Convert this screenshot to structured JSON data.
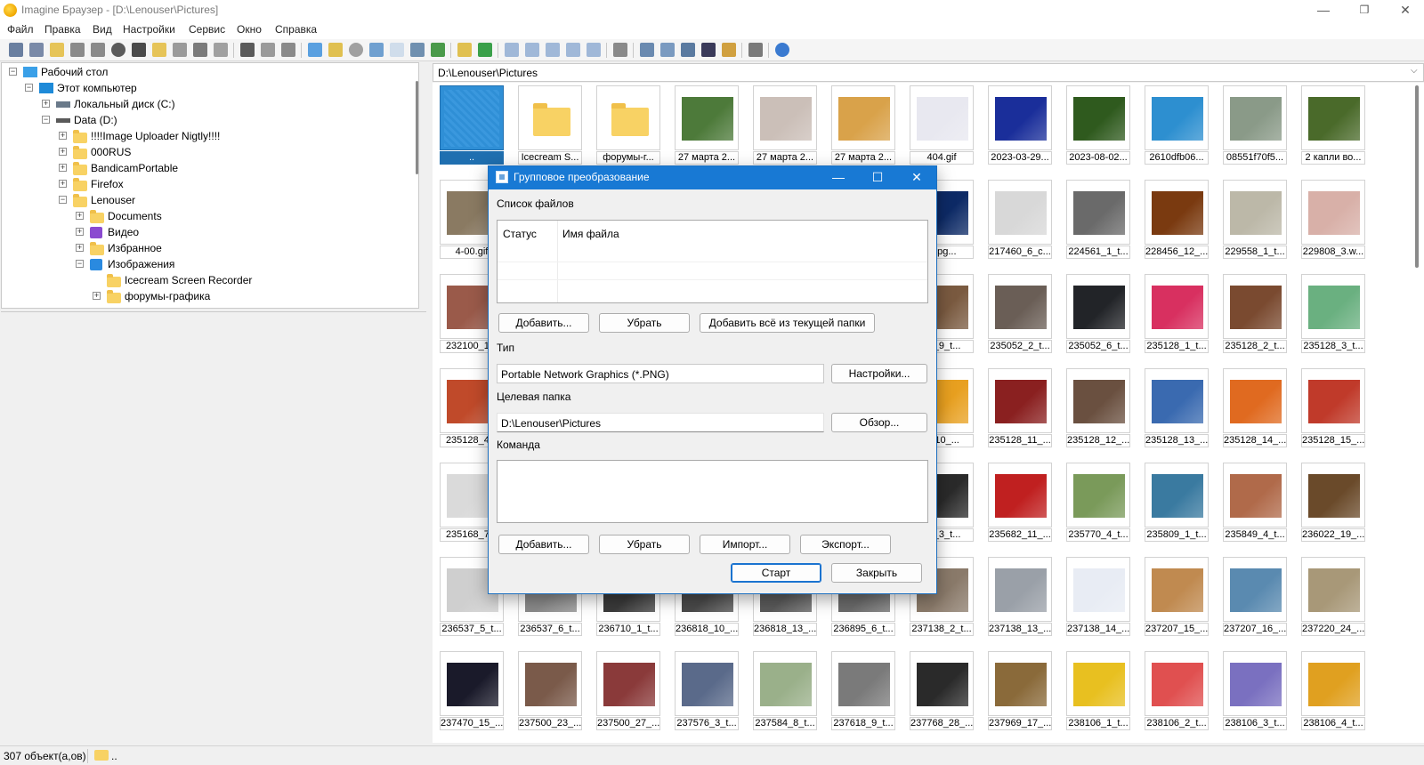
{
  "window": {
    "title": "Imagine Браузер - [D:\\Lenouser\\Pictures]"
  },
  "menu": [
    "Файл",
    "Правка",
    "Вид",
    "Настройки",
    "Сервис",
    "Окно",
    "Справка"
  ],
  "tree": [
    {
      "label": "Рабочий стол",
      "icon": "desktop-icon"
    },
    {
      "label": "Этот компьютер",
      "icon": "computer-icon"
    },
    {
      "label": "Локальный диск (C:)",
      "icon": "drive-icon"
    },
    {
      "label": "Data (D:)",
      "icon": "drive-icon"
    },
    {
      "label": "!!!!Image Uploader Nigtly!!!!",
      "icon": "folder-icon"
    },
    {
      "label": "000RUS",
      "icon": "folder-icon"
    },
    {
      "label": "BandicamPortable",
      "icon": "folder-icon"
    },
    {
      "label": "Firefox",
      "icon": "folder-icon"
    },
    {
      "label": "Lenouser",
      "icon": "folder-icon"
    },
    {
      "label": "Documents",
      "icon": "folder-icon"
    },
    {
      "label": "Видео",
      "icon": "video-folder-icon"
    },
    {
      "label": "Избранное",
      "icon": "folder-icon"
    },
    {
      "label": "Изображения",
      "icon": "pictures-folder-icon"
    },
    {
      "label": "Icecream Screen Recorder",
      "icon": "folder-icon"
    },
    {
      "label": "форумы-графика",
      "icon": "folder-icon"
    }
  ],
  "path": "D:\\Lenouser\\Pictures",
  "thumbnails": [
    {
      "caption": "..",
      "kind": "up",
      "color": "#2f8fd6"
    },
    {
      "caption": "Icecream S...",
      "kind": "folder",
      "color": "#f8d264"
    },
    {
      "caption": "форумы-г...",
      "kind": "folder",
      "color": "#f8d264"
    },
    {
      "caption": "27 марта 2...",
      "kind": "image",
      "color": "#4d7a3a"
    },
    {
      "caption": "27 марта 2...",
      "kind": "image",
      "color": "#cbbfb8"
    },
    {
      "caption": "27 марта 2...",
      "kind": "image",
      "color": "#d9a24a"
    },
    {
      "caption": "404.gif",
      "kind": "image",
      "color": "#e8e8f0"
    },
    {
      "caption": "2023-03-29...",
      "kind": "image",
      "color": "#1a2e9a"
    },
    {
      "caption": "2023-08-02...",
      "kind": "image",
      "color": "#2f5a1e"
    },
    {
      "caption": "2610dfb06...",
      "kind": "image",
      "color": "#2d8fd0"
    },
    {
      "caption": "08551f70f5...",
      "kind": "image",
      "color": "#8a9a88"
    },
    {
      "caption": "2 капли во...",
      "kind": "image",
      "color": "#4a6a2a"
    },
    {
      "caption": "4-00.gif",
      "kind": "image",
      "color": "#8a7a62"
    },
    {
      "caption": "",
      "kind": "hidden",
      "color": "#f0f0f0"
    },
    {
      "caption": "",
      "kind": "hidden",
      "color": "#f0f0f0"
    },
    {
      "caption": "",
      "kind": "hidden",
      "color": "#f0f0f0"
    },
    {
      "caption": "",
      "kind": "hidden",
      "color": "#f0f0f0"
    },
    {
      "caption": "",
      "kind": "hidden",
      "color": "#f0f0f0"
    },
    {
      "caption": "6.jpg...",
      "kind": "image",
      "color": "#0d2a66"
    },
    {
      "caption": "217460_6_c...",
      "kind": "image",
      "color": "#d8d8d8"
    },
    {
      "caption": "224561_1_t...",
      "kind": "image",
      "color": "#6a6a6a"
    },
    {
      "caption": "228456_12_...",
      "kind": "image",
      "color": "#7a3a10"
    },
    {
      "caption": "229558_1_t...",
      "kind": "image",
      "color": "#bcb8a8"
    },
    {
      "caption": "229808_3.w...",
      "kind": "image",
      "color": "#d8b0a8"
    },
    {
      "caption": "232100_1...",
      "kind": "image",
      "color": "#9a5a4a"
    },
    {
      "caption": "",
      "kind": "hidden",
      "color": "#f0f0f0"
    },
    {
      "caption": "",
      "kind": "hidden",
      "color": "#f0f0f0"
    },
    {
      "caption": "",
      "kind": "hidden",
      "color": "#f0f0f0"
    },
    {
      "caption": "",
      "kind": "hidden",
      "color": "#f0f0f0"
    },
    {
      "caption": "",
      "kind": "hidden",
      "color": "#f0f0f0"
    },
    {
      "caption": "47_9_t...",
      "kind": "image",
      "color": "#7a5a40"
    },
    {
      "caption": "235052_2_t...",
      "kind": "image",
      "color": "#6a5e56"
    },
    {
      "caption": "235052_6_t...",
      "kind": "image",
      "color": "#222428"
    },
    {
      "caption": "235128_1_t...",
      "kind": "image",
      "color": "#d83060"
    },
    {
      "caption": "235128_2_t...",
      "kind": "image",
      "color": "#7a4a30"
    },
    {
      "caption": "235128_3_t...",
      "kind": "image",
      "color": "#6ab080"
    },
    {
      "caption": "235128_4...",
      "kind": "image",
      "color": "#c04a2a"
    },
    {
      "caption": "",
      "kind": "hidden",
      "color": "#f0f0f0"
    },
    {
      "caption": "",
      "kind": "hidden",
      "color": "#f0f0f0"
    },
    {
      "caption": "",
      "kind": "hidden",
      "color": "#f0f0f0"
    },
    {
      "caption": "",
      "kind": "hidden",
      "color": "#f0f0f0"
    },
    {
      "caption": "",
      "kind": "hidden",
      "color": "#f0f0f0"
    },
    {
      "caption": "8_10_...",
      "kind": "image",
      "color": "#e8a020"
    },
    {
      "caption": "235128_11_...",
      "kind": "image",
      "color": "#8a2020"
    },
    {
      "caption": "235128_12_...",
      "kind": "image",
      "color": "#6a5040"
    },
    {
      "caption": "235128_13_...",
      "kind": "image",
      "color": "#3a6ab0"
    },
    {
      "caption": "235128_14_...",
      "kind": "image",
      "color": "#e06a20"
    },
    {
      "caption": "235128_15_...",
      "kind": "image",
      "color": "#c03a2a"
    },
    {
      "caption": "235168_7...",
      "kind": "image",
      "color": "#dadada"
    },
    {
      "caption": "",
      "kind": "hidden",
      "color": "#f0f0f0"
    },
    {
      "caption": "",
      "kind": "hidden",
      "color": "#f0f0f0"
    },
    {
      "caption": "",
      "kind": "hidden",
      "color": "#f0f0f0"
    },
    {
      "caption": "",
      "kind": "hidden",
      "color": "#f0f0f0"
    },
    {
      "caption": "",
      "kind": "hidden",
      "color": "#f0f0f0"
    },
    {
      "caption": "32_3_t...",
      "kind": "image",
      "color": "#2a2a2a"
    },
    {
      "caption": "235682_11_...",
      "kind": "image",
      "color": "#c02020"
    },
    {
      "caption": "235770_4_t...",
      "kind": "image",
      "color": "#7a9a5a"
    },
    {
      "caption": "235809_1_t...",
      "kind": "image",
      "color": "#3a7aa0"
    },
    {
      "caption": "235849_4_t...",
      "kind": "image",
      "color": "#b06a4a"
    },
    {
      "caption": "236022_19_...",
      "kind": "image",
      "color": "#6a4a2a"
    },
    {
      "caption": "236537_5_t...",
      "kind": "image",
      "color": "#cfcfcf"
    },
    {
      "caption": "236537_6_t...",
      "kind": "image",
      "color": "#8a8a8a"
    },
    {
      "caption": "236710_1_t...",
      "kind": "image",
      "color": "#3a3a3a"
    },
    {
      "caption": "236818_10_...",
      "kind": "image",
      "color": "#4a4a4a"
    },
    {
      "caption": "236818_13_...",
      "kind": "image",
      "color": "#5a5a5a"
    },
    {
      "caption": "236895_6_t...",
      "kind": "image",
      "color": "#6a6a6a"
    },
    {
      "caption": "237138_2_t...",
      "kind": "image",
      "color": "#8a7a6a"
    },
    {
      "caption": "237138_13_...",
      "kind": "image",
      "color": "#9aa0a8"
    },
    {
      "caption": "237138_14_...",
      "kind": "image",
      "color": "#e8ecf4"
    },
    {
      "caption": "237207_15_...",
      "kind": "image",
      "color": "#c08a50"
    },
    {
      "caption": "237207_16_...",
      "kind": "image",
      "color": "#5a8ab0"
    },
    {
      "caption": "237220_24_...",
      "kind": "image",
      "color": "#a89878"
    },
    {
      "caption": "237470_15_...",
      "kind": "image",
      "color": "#1a1a2a"
    },
    {
      "caption": "237500_23_...",
      "kind": "image",
      "color": "#7a5a4a"
    },
    {
      "caption": "237500_27_...",
      "kind": "image",
      "color": "#8a3a3a"
    },
    {
      "caption": "237576_3_t...",
      "kind": "image",
      "color": "#5a6a8a"
    },
    {
      "caption": "237584_8_t...",
      "kind": "image",
      "color": "#9ab08a"
    },
    {
      "caption": "237618_9_t...",
      "kind": "image",
      "color": "#7a7a7a"
    },
    {
      "caption": "237768_28_...",
      "kind": "image",
      "color": "#2a2a2a"
    },
    {
      "caption": "237969_17_...",
      "kind": "image",
      "color": "#8a6a3a"
    },
    {
      "caption": "238106_1_t...",
      "kind": "image",
      "color": "#e8c020"
    },
    {
      "caption": "238106_2_t...",
      "kind": "image",
      "color": "#e05050"
    },
    {
      "caption": "238106_3_t...",
      "kind": "image",
      "color": "#7a70c0"
    },
    {
      "caption": "238106_4_t...",
      "kind": "image",
      "color": "#e0a020"
    }
  ],
  "status": {
    "count": "307 объект(а,ов)",
    "folder": ".."
  },
  "dialog": {
    "title": "Групповое преобразование",
    "files_label": "Список файлов",
    "col_status": "Статус",
    "col_filename": "Имя файла",
    "btn_add": "Добавить...",
    "btn_remove": "Убрать",
    "btn_add_all": "Добавить всё из текущей папки",
    "type_label": "Тип",
    "type_value": "Portable Network Graphics (*.PNG)",
    "btn_settings": "Настройки...",
    "target_label": "Целевая папка",
    "target_value": "D:\\Lenouser\\Pictures",
    "btn_browse": "Обзор...",
    "command_label": "Команда",
    "btn_cmd_add": "Добавить...",
    "btn_cmd_remove": "Убрать",
    "btn_import": "Импорт...",
    "btn_export": "Экспорт...",
    "btn_start": "Старт",
    "btn_close": "Закрыть"
  },
  "colors": {
    "accent": "#1879d4",
    "folder": "#f8d264"
  }
}
